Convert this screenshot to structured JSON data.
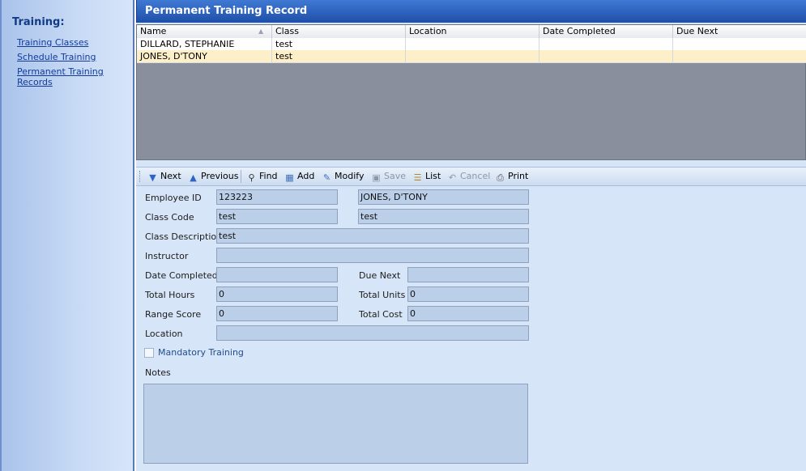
{
  "sidebar": {
    "title": "Training:",
    "links": [
      "Training Classes",
      "Schedule Training",
      "Permanent Training Records"
    ]
  },
  "header": {
    "title": "Permanent Training Record"
  },
  "grid": {
    "columns": [
      "Name",
      "Class",
      "Location",
      "Date Completed",
      "Due Next"
    ],
    "rows": [
      [
        "DILLARD, STEPHANIE",
        "test",
        "",
        "",
        ""
      ],
      [
        "JONES, D'TONY",
        "test",
        "",
        "",
        ""
      ]
    ],
    "selected_row": 1
  },
  "toolbar": {
    "next": "Next",
    "previous": "Previous",
    "find": "Find",
    "add": "Add",
    "modify": "Modify",
    "save": "Save",
    "list": "List",
    "cancel": "Cancel",
    "print": "Print"
  },
  "form": {
    "employee_id_label": "Employee ID",
    "employee_id": "123223",
    "employee_name": "JONES, D'TONY",
    "class_code_label": "Class Code",
    "class_code": "test",
    "class_name": "test",
    "class_description_label": "Class Description",
    "class_description": "test",
    "instructor_label": "Instructor",
    "instructor": "",
    "date_completed_label": "Date Completed",
    "date_completed": "",
    "due_next_label": "Due Next",
    "due_next": "",
    "total_hours_label": "Total Hours",
    "total_hours": "0",
    "total_units_label": "Total Units",
    "total_units": "0",
    "range_score_label": "Range Score",
    "range_score": "0",
    "total_cost_label": "Total Cost",
    "total_cost": "0",
    "location_label": "Location",
    "location": "",
    "mandatory_label": "Mandatory Training",
    "mandatory_checked": false,
    "notes_label": "Notes",
    "notes": ""
  },
  "colors": {
    "header_blue": "#1f4fa8",
    "selected_row": "#fdf0c8",
    "form_bg": "#d6e5f7",
    "field_bg": "#bccfe8",
    "grid_empty": "#898f9c"
  }
}
